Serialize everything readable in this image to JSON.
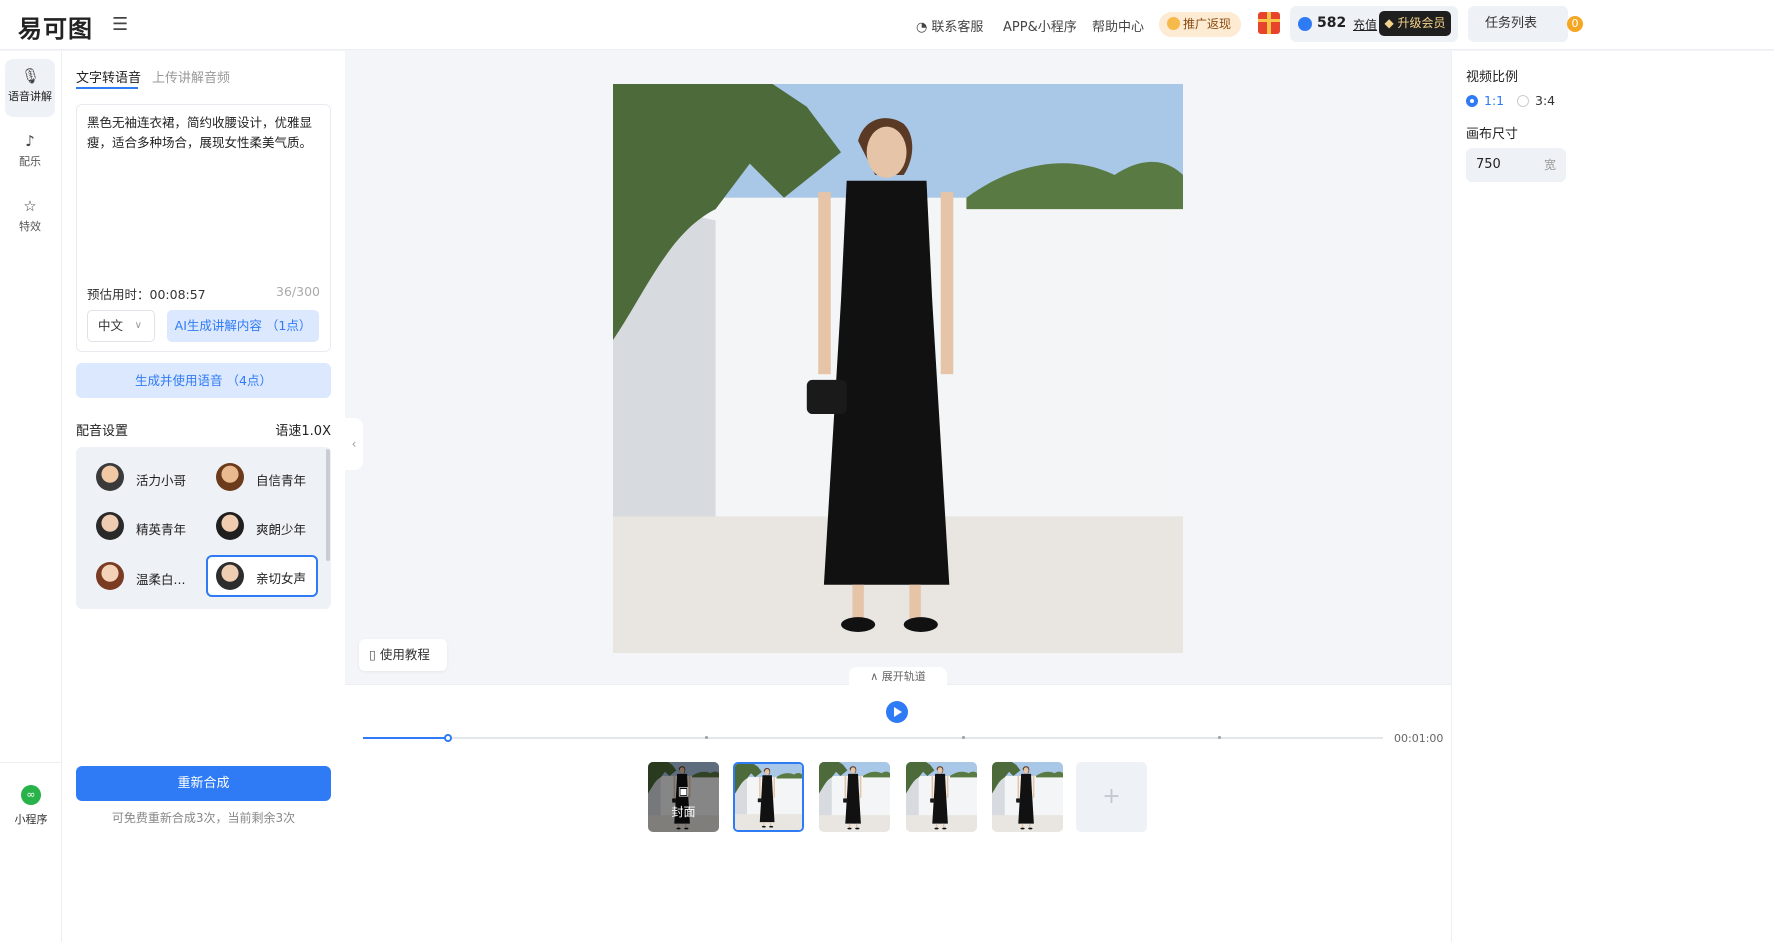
{
  "header": {
    "logo": "易可图",
    "contact": "联系客服",
    "app": "APP&小程序",
    "help": "帮助中心",
    "promo": "推广返现",
    "points": "582",
    "recharge": "充值",
    "upgrade": "升级会员",
    "tasks": "任务列表",
    "task_count": "0"
  },
  "rail": {
    "items": [
      {
        "label": "语音讲解",
        "icon": "microphone-icon"
      },
      {
        "label": "配乐",
        "icon": "music-icon"
      },
      {
        "label": "特效",
        "icon": "sparkle-icon"
      }
    ],
    "mini_program": "小程序"
  },
  "panel": {
    "tabs": [
      "文字转语音",
      "上传讲解音频"
    ],
    "tts_text": "黑色无袖连衣裙，简约收腰设计，优雅显瘦，适合多种场合，展现女性柔美气质。",
    "est_label": "预估用时：00:08:57",
    "char_count": "36/300",
    "language": "中文",
    "ai_button": "AI生成讲解内容 （1点）",
    "generate_button": "生成并使用语音 （4点）",
    "dub_title": "配音设置",
    "dub_speed": "语速1.0X",
    "voices": [
      {
        "name": "活力小哥",
        "selected": false
      },
      {
        "name": "自信青年",
        "selected": false
      },
      {
        "name": "精英青年",
        "selected": false
      },
      {
        "name": "爽朗少年",
        "selected": false
      },
      {
        "name": "温柔白...",
        "selected": false
      },
      {
        "name": "亲切女声",
        "selected": true
      }
    ],
    "resynth_button": "重新合成",
    "free_note": "可免费重新合成3次，当前剩余3次"
  },
  "canvas": {
    "tutorial": "使用教程"
  },
  "timeline": {
    "expand": "展开轨道",
    "progress": 0.083,
    "end_time": "00:01:00",
    "cover_label": "封面",
    "add_icon": "+"
  },
  "right": {
    "ratio_title": "视频比例",
    "ratios": [
      "1:1",
      "3:4"
    ],
    "selected_ratio": "1:1",
    "size_title": "画布尺寸",
    "width_value": "750",
    "width_suffix": "宽"
  },
  "colors": {
    "accent": "#2f7bf5",
    "dress": "#111111",
    "sky": "#a9c7e6",
    "wall": "#eeeff0"
  }
}
